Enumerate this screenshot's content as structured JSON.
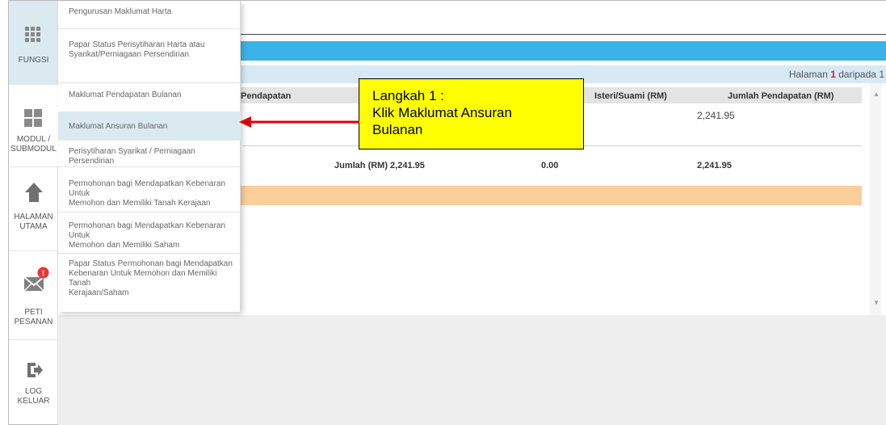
{
  "sidebar": {
    "items": [
      {
        "label": "FUNGSI",
        "icon": "grid-icon"
      },
      {
        "label_1": "MODUL /",
        "label_2": "SUBMODUL",
        "icon": "modules-icon"
      },
      {
        "label_1": "HALAMAN",
        "label_2": "UTAMA",
        "icon": "home-icon"
      },
      {
        "label_1": "PETI",
        "label_2": "PESANAN",
        "icon": "mail-icon",
        "badge": "!"
      },
      {
        "label_1": "LOG",
        "label_2": "KELUAR",
        "icon": "logout-icon"
      }
    ]
  },
  "menu": {
    "items": [
      {
        "lines": [
          "Pengurusan Maklumat Harta"
        ]
      },
      {
        "lines": [
          "Papar Status Perisytiharan Harta atau",
          "Syarikat/Perniagaan Persendirian"
        ]
      },
      {
        "lines": [
          "Maklumat Pendapatan Bulanan"
        ]
      },
      {
        "lines": [
          "Maklumat Ansuran Bulanan"
        ],
        "active": true
      },
      {
        "lines": [
          "Perisytiharan Syarikat / Perniagaan Persendirian"
        ]
      },
      {
        "lines": [
          "Permohonan bagi Mendapatkan Kebenaran Untuk",
          "Memohon dan Memiliki Tanah Kerajaan"
        ]
      },
      {
        "lines": [
          "Permohonan bagi Mendapatkan Kebenaran Untuk",
          "Memohon dan Memiliki Saham"
        ]
      },
      {
        "lines": [
          "Papar Status Permohonan bagi Mendapatkan",
          "Kebenaran Untuk Memohon dan Memiliki Tanah",
          "Kerajaan/Saham"
        ]
      }
    ]
  },
  "pagination": {
    "prefix": "Halaman",
    "current": "1",
    "middle": "daripada",
    "total": "1"
  },
  "table": {
    "headers": {
      "col1": "Pendapatan",
      "col3": "Isteri/Suami (RM)",
      "col4": "Jumlah Pendapatan (RM)"
    },
    "row1": {
      "total": "2,241.95"
    },
    "totals": {
      "label": "Jumlah (RM) 2,241.95",
      "spouse": "0.00",
      "total": "2,241.95"
    }
  },
  "callout": {
    "line1": "Langkah 1 :",
    "line2": "Klik Maklumat Ansuran",
    "line3": "Bulanan"
  },
  "colors": {
    "accent": "#3bb3e8",
    "callout": "#ffff00",
    "arrow": "#e0000a",
    "highlight": "#fccf9a",
    "badge": "#e53935"
  }
}
